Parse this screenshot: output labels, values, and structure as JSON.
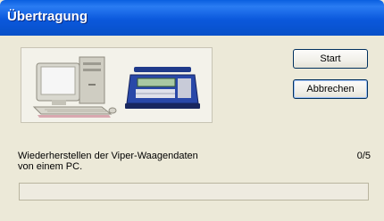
{
  "window": {
    "title": "Übertragung"
  },
  "buttons": {
    "start": "Start",
    "cancel": "Abbrechen"
  },
  "status": {
    "line1": "Wiederherstellen der Viper-Waagendaten",
    "line2": "von einem PC.",
    "counter": "0/5"
  },
  "progress": {
    "fraction": 0
  },
  "icons": [
    "computer-icon",
    "scale-icon"
  ]
}
